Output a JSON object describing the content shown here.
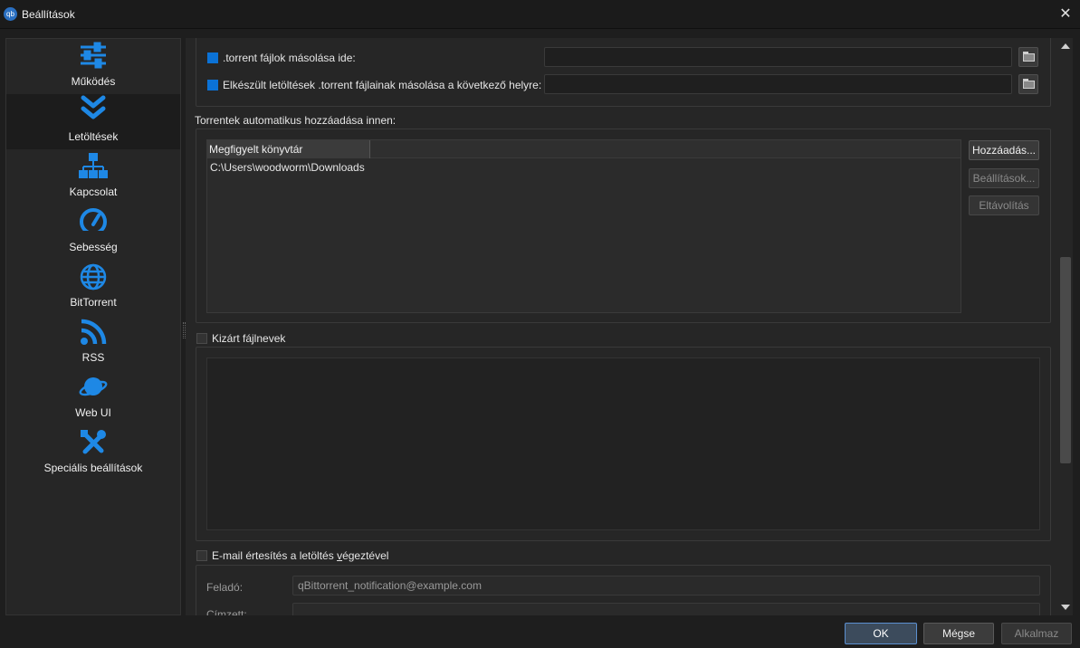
{
  "window": {
    "title": "Beállítások",
    "app_icon_text": "qb"
  },
  "sidebar": {
    "items": [
      {
        "label": "Működés",
        "icon": "sliders-icon"
      },
      {
        "label": "Letöltések",
        "icon": "double-chevron-down-icon"
      },
      {
        "label": "Kapcsolat",
        "icon": "network-icon"
      },
      {
        "label": "Sebesség",
        "icon": "speedometer-icon"
      },
      {
        "label": "BitTorrent",
        "icon": "globe-icon"
      },
      {
        "label": "RSS",
        "icon": "rss-icon"
      },
      {
        "label": "Web UI",
        "icon": "planet-icon"
      },
      {
        "label": "Speciális beállítások",
        "icon": "tools-icon"
      }
    ],
    "active_index": 1,
    "icon_color": "#1e88e5"
  },
  "copy_torrents": {
    "label": ".torrent fájlok másolása ide:",
    "checked": true,
    "path": ""
  },
  "copy_finished": {
    "label": "Elkészült letöltések .torrent fájlainak másolása a következő helyre:",
    "checked": true,
    "path": ""
  },
  "auto_add": {
    "title": "Torrentek automatikus hozzáadása innen:",
    "column_header": "Megfigyelt könyvtár",
    "rows": [
      "C:\\Users\\woodworm\\Downloads"
    ],
    "add_button": "Hozzáadás...",
    "options_button": "Beállítások...",
    "remove_button": "Eltávolítás"
  },
  "excluded": {
    "label": "Kizárt fájlnevek",
    "checked": false
  },
  "email": {
    "label_prefix": "E-mail értesítés a letöltés ",
    "label_underlined": "v",
    "label_suffix": "égeztével",
    "checked": false,
    "from_label": "Feladó:",
    "from_value": "qBittorrent_notification@example.com",
    "to_label": "Címzett:"
  },
  "buttons": {
    "ok": "OK",
    "cancel": "Mégse",
    "apply": "Alkalmaz"
  }
}
